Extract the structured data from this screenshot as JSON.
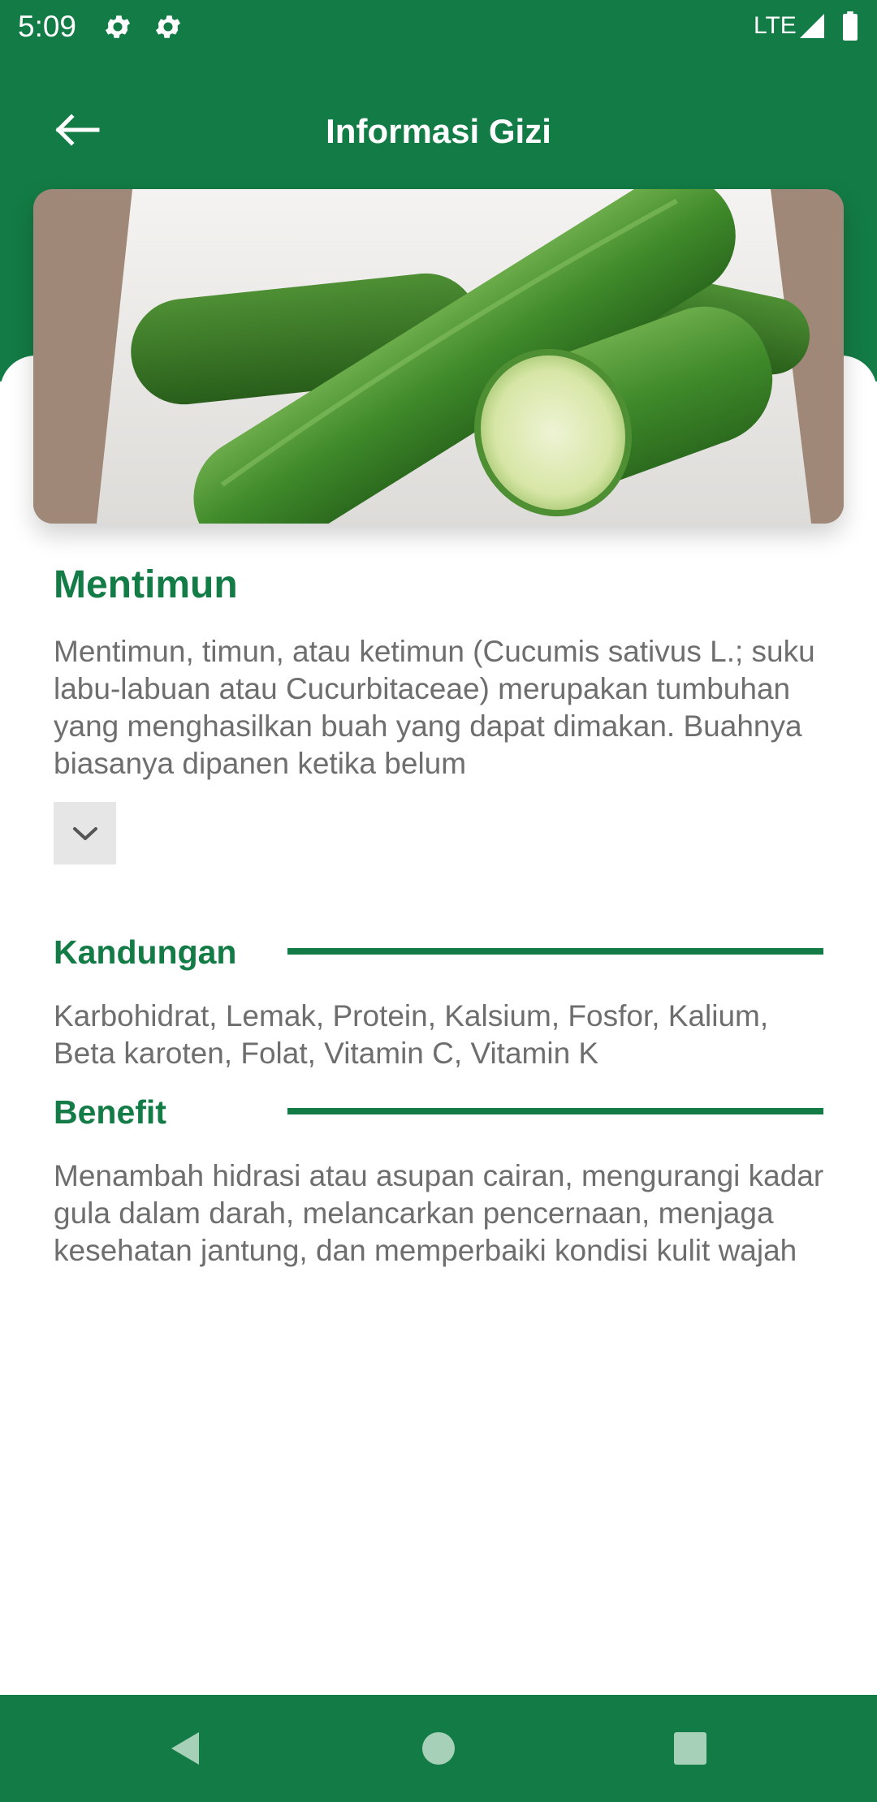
{
  "status_bar": {
    "time": "5:09",
    "network": "LTE",
    "icons": [
      "gear-icon",
      "gear-icon",
      "signal-icon",
      "battery-icon"
    ]
  },
  "app_bar": {
    "title": "Informasi Gizi",
    "back_icon": "arrow-left-icon"
  },
  "colors": {
    "primary": "#137b45",
    "body_text": "#6e6e6e",
    "expand_bg": "#e6e6e6"
  },
  "food": {
    "name": "Mentimun",
    "description": "Mentimun, timun, atau ketimun (Cucumis sativus L.; suku labu-labuan atau Cucurbitaceae) merupakan tumbuhan yang menghasilkan buah yang dapat dimakan. Buahnya biasanya dipanen ketika belum",
    "expand_icon": "chevron-down-icon"
  },
  "sections": {
    "kandungan": {
      "title": "Kandungan",
      "text": "Karbohidrat, Lemak, Protein, Kalsium, Fosfor, Kalium, Beta karoten, Folat, Vitamin C, Vitamin K"
    },
    "benefit": {
      "title": "Benefit",
      "text": "Menambah hidrasi atau asupan cairan, mengurangi kadar gula dalam darah, melancarkan pencernaan, menjaga kesehatan jantung, dan memperbaiki kondisi kulit wajah"
    }
  },
  "nav_bar": {
    "icons": [
      "nav-back-icon",
      "nav-home-icon",
      "nav-recents-icon"
    ]
  }
}
